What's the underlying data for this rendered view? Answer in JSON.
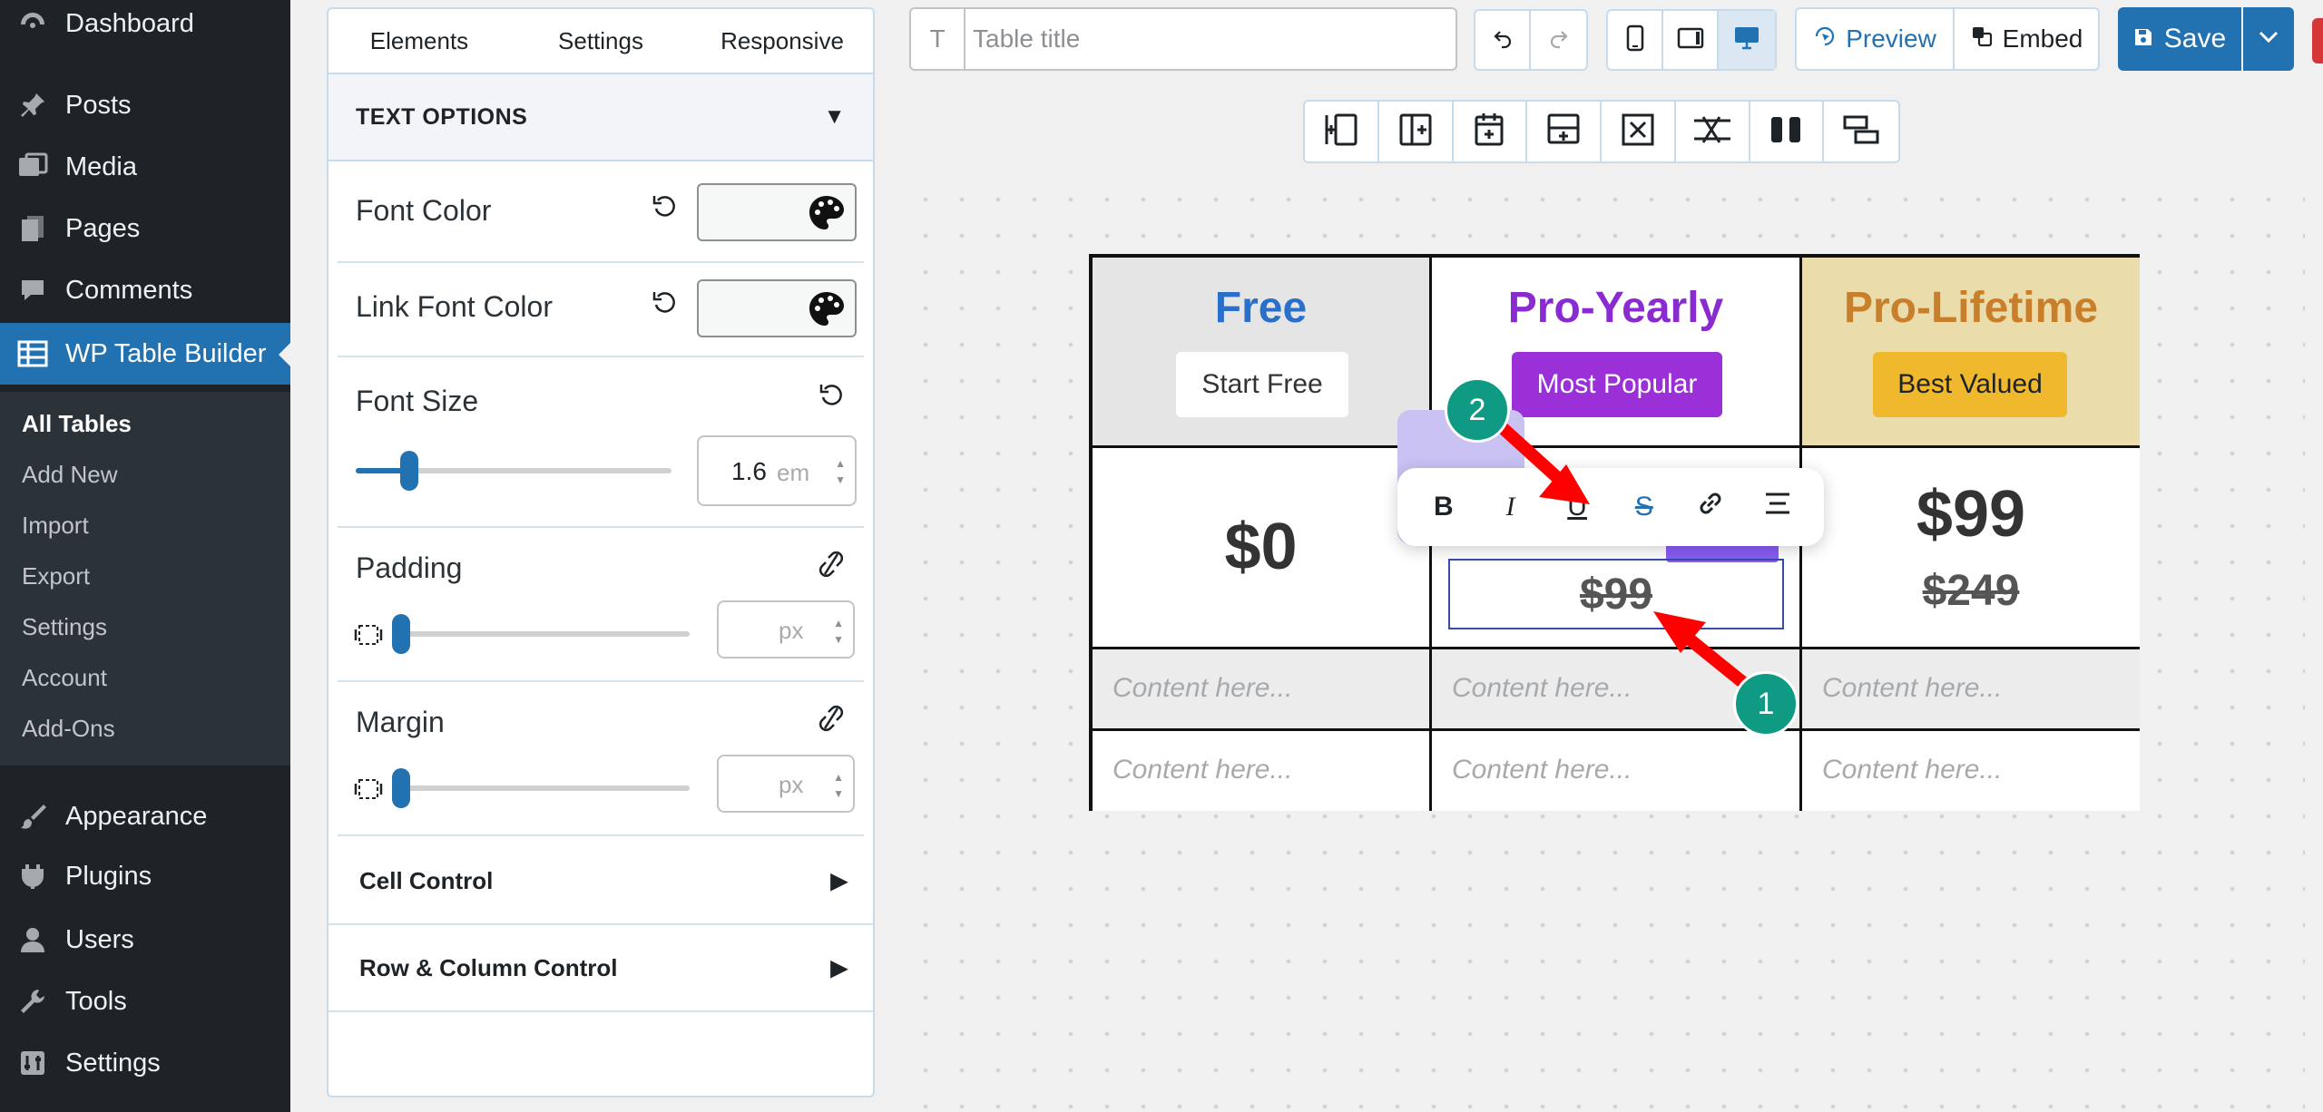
{
  "wp_menu": {
    "items": [
      {
        "label": "Dashboard",
        "icon": "dashboard-icon"
      },
      {
        "label": "Posts",
        "icon": "pin-icon"
      },
      {
        "label": "Media",
        "icon": "media-icon"
      },
      {
        "label": "Pages",
        "icon": "pages-icon"
      },
      {
        "label": "Comments",
        "icon": "comment-icon"
      },
      {
        "label": "WP Table Builder",
        "icon": "table-icon"
      },
      {
        "label": "Appearance",
        "icon": "brush-icon"
      },
      {
        "label": "Plugins",
        "icon": "plugin-icon"
      },
      {
        "label": "Users",
        "icon": "user-icon"
      },
      {
        "label": "Tools",
        "icon": "wrench-icon"
      },
      {
        "label": "Settings",
        "icon": "settings-icon"
      }
    ],
    "submenu": [
      "All Tables",
      "Add New",
      "Import",
      "Export",
      "Settings",
      "Account",
      "Add-Ons"
    ],
    "current_submenu": "All Tables"
  },
  "panel": {
    "tabs": [
      "Elements",
      "Settings",
      "Responsive"
    ],
    "text_options": "TEXT OPTIONS",
    "font_color": "Font Color",
    "link_font_color": "Link Font Color",
    "font_size": {
      "label": "Font Size",
      "value": "1.6",
      "unit": "em",
      "slider_fraction": 0.17
    },
    "padding": {
      "label": "Padding",
      "unit": "px",
      "slider_fraction": 0.0
    },
    "margin": {
      "label": "Margin",
      "unit": "px",
      "slider_fraction": 0.0
    },
    "cell_control": "Cell Control",
    "row_column_control": "Row & Column Control"
  },
  "toolbar": {
    "title_icon": "T",
    "title_placeholder": "Table title",
    "preview": "Preview",
    "embed": "Embed",
    "save": "Save"
  },
  "table": {
    "plans": [
      {
        "name": "Free",
        "button": "Start Free",
        "price": "$0",
        "old_price": ""
      },
      {
        "name": "Pro-Yearly",
        "button": "Most Popular",
        "price": "",
        "old_price": "$99"
      },
      {
        "name": "Pro-Lifetime",
        "button": "Best Valued",
        "price": "$99",
        "old_price": "$249"
      }
    ],
    "placeholder": "Content here..."
  },
  "format_toolbar": [
    "B",
    "I",
    "U",
    "S",
    "link",
    "align"
  ],
  "callouts": [
    "1",
    "2"
  ],
  "colors": {
    "wp_dark": "#1d2327",
    "wp_blue": "#2271b1",
    "free": "#2a6fc9",
    "pro_yearly": "#8a2bd2",
    "pro_lifetime": "#c97f2a",
    "callout": "#0f9a84",
    "arrow": "#ff0000"
  }
}
